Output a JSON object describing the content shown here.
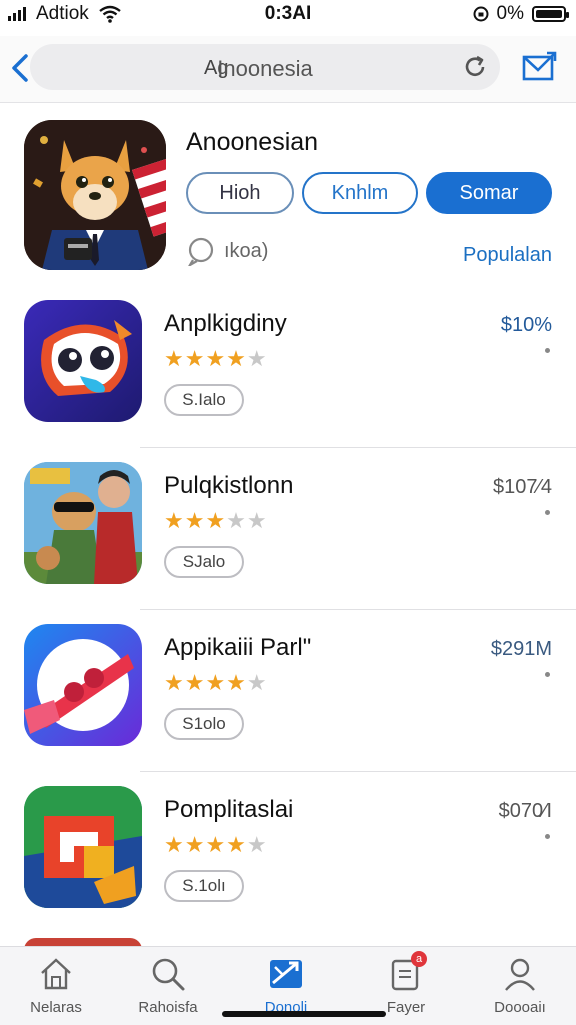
{
  "status": {
    "carrier": "Adtiok",
    "time": "0:3AI",
    "battery": "0%"
  },
  "nav": {
    "lock_symbol": "Ag",
    "query": "Inoonesia"
  },
  "featured": {
    "title": "Anoonesian",
    "buttons": [
      "Hioh",
      "Knhlm",
      "Somar"
    ],
    "meta": "ıkoa)",
    "link": "Populalan"
  },
  "apps": [
    {
      "name": "Anplkigdiny",
      "rating": 4,
      "size": "S.Ialo",
      "price": "$10%",
      "price_color": "#235a9a"
    },
    {
      "name": "Pulqkistlonn",
      "rating": 3,
      "size": "SJalo",
      "price": "$107⁄4",
      "price_color": "#555555"
    },
    {
      "name": "Appikaiii Parl\"",
      "rating": 4,
      "size": "S1olo",
      "price": "$291M",
      "price_color": "#3a5a80"
    },
    {
      "name": "Pomplitaslai",
      "rating": 4,
      "size": "S.1olı",
      "price": "$070⁄I",
      "price_color": "#555555"
    }
  ],
  "tabs": [
    {
      "label": "Nelaras",
      "icon": "home-icon"
    },
    {
      "label": "Rahoisfa",
      "icon": "search-icon"
    },
    {
      "label": "Donoli",
      "icon": "apps-icon"
    },
    {
      "label": "Fayer",
      "icon": "updates-icon",
      "badge": "a"
    },
    {
      "label": "Doooaiı",
      "icon": "profile-icon"
    }
  ],
  "colors": {
    "accent": "#1a6fd1",
    "star": "#f0a020",
    "badge": "#e0353b"
  }
}
